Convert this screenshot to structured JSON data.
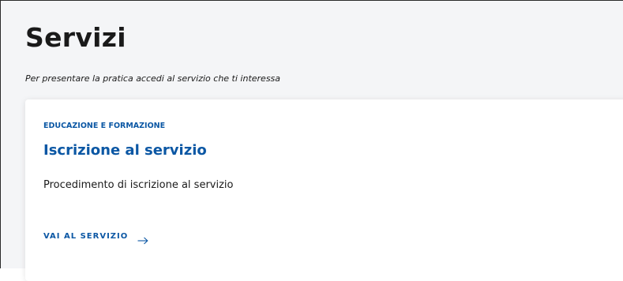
{
  "page": {
    "title": "Servizi",
    "subtitle": "Per presentare la pratica accedi al servizio che ti interessa"
  },
  "service_card": {
    "category": "EDUCAZIONE E FORMAZIONE",
    "title": "Iscrizione al servizio",
    "description": "Procedimento di iscrizione al servizio",
    "link_label": "VAI AL SERVIZIO",
    "link_icon": "arrow-right-icon"
  },
  "colors": {
    "accent": "#0b57a4",
    "text": "#1a1a1a",
    "background": "#f4f5f7",
    "card": "#ffffff"
  }
}
